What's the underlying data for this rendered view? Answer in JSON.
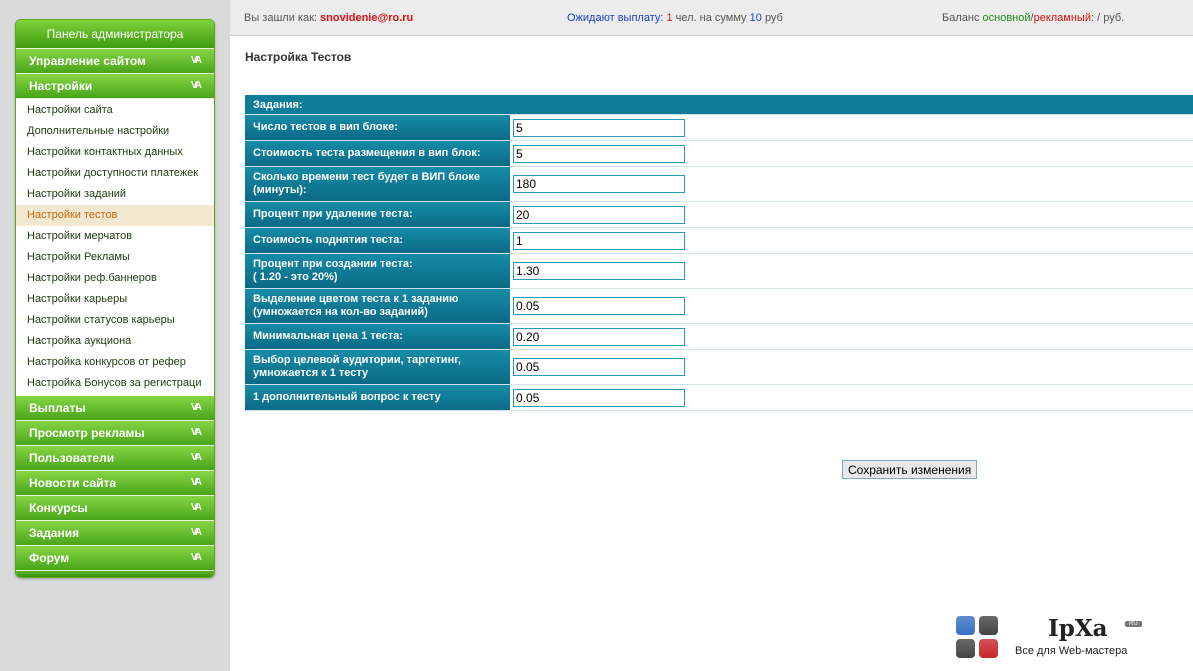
{
  "sidebar": {
    "title": "Панель администратора",
    "sections": {
      "site": "Управление сайтом",
      "settings": "Настройки",
      "payouts": "Выплаты",
      "ads": "Просмотр рекламы",
      "users": "Пользователи",
      "news": "Новости сайта",
      "contests": "Конкурсы",
      "tasks": "Задания",
      "forum": "Форум"
    },
    "settings_items": [
      "Настройки сайта",
      "Дополнительные настройки",
      "Настройки контактных данных",
      "Настройки доступности платежек",
      "Настройки заданий",
      "Настройки тестов",
      "Настройки мерчатов",
      "Настройки Рекламы",
      "Настройки реф.баннеров",
      "Настройки карьеры",
      "Настройки статусов карьеры",
      "Настройка аукциона",
      "Настройка конкурсов от рефер",
      "Настройка Бонусов за регистраци"
    ],
    "active_item": "Настройки тестов",
    "chevron": "VA"
  },
  "topbar": {
    "login_label": "Вы зашли как:",
    "login_user": "snovidenie@ro.ru",
    "payout_label": "Ожидают выплату:",
    "payout_count": "1",
    "payout_mid": "чел. на сумму",
    "payout_sum": "10",
    "payout_currency": "руб",
    "balance_label": "Баланс",
    "balance_main": "основной",
    "balance_sep": "/",
    "balance_ad": "рекламный",
    "balance_tail": ": / руб."
  },
  "page": {
    "title": "Настройка Тестов",
    "section_header": "Задания:",
    "fields": [
      {
        "label": "Число тестов в вип блоке:",
        "value": "5"
      },
      {
        "label": "Стоимость теста размещения в вип блок:",
        "value": "5"
      },
      {
        "label": "Сколько времени тест будет в ВИП блоке (минуты):",
        "value": "180"
      },
      {
        "label": "Процент при удаление теста:",
        "value": "20"
      },
      {
        "label": "Стоимость поднятия теста:",
        "value": "1"
      },
      {
        "label": "Процент при создании теста:\n( 1.20 - это 20%)",
        "value": "1.30"
      },
      {
        "label": "Выделение цветом теста к 1 заданию (умножается на кол-во заданий)",
        "value": "0.05"
      },
      {
        "label": "Минимальная цена 1 теста:",
        "value": "0.20"
      },
      {
        "label": "Выбор целевой аудитории, таргетинг, умножается к 1 тесту",
        "value": "0.05"
      },
      {
        "label": "1 дополнительный вопрос к тесту",
        "value": "0.05"
      }
    ],
    "save_label": "Сохранить изменения"
  },
  "logo": {
    "name": "IpXa",
    "badge": "RU",
    "tagline": "Все для Web-мастера",
    "colors": [
      "#3b6fc4",
      "#444444",
      "#444444",
      "#c8262b"
    ]
  }
}
